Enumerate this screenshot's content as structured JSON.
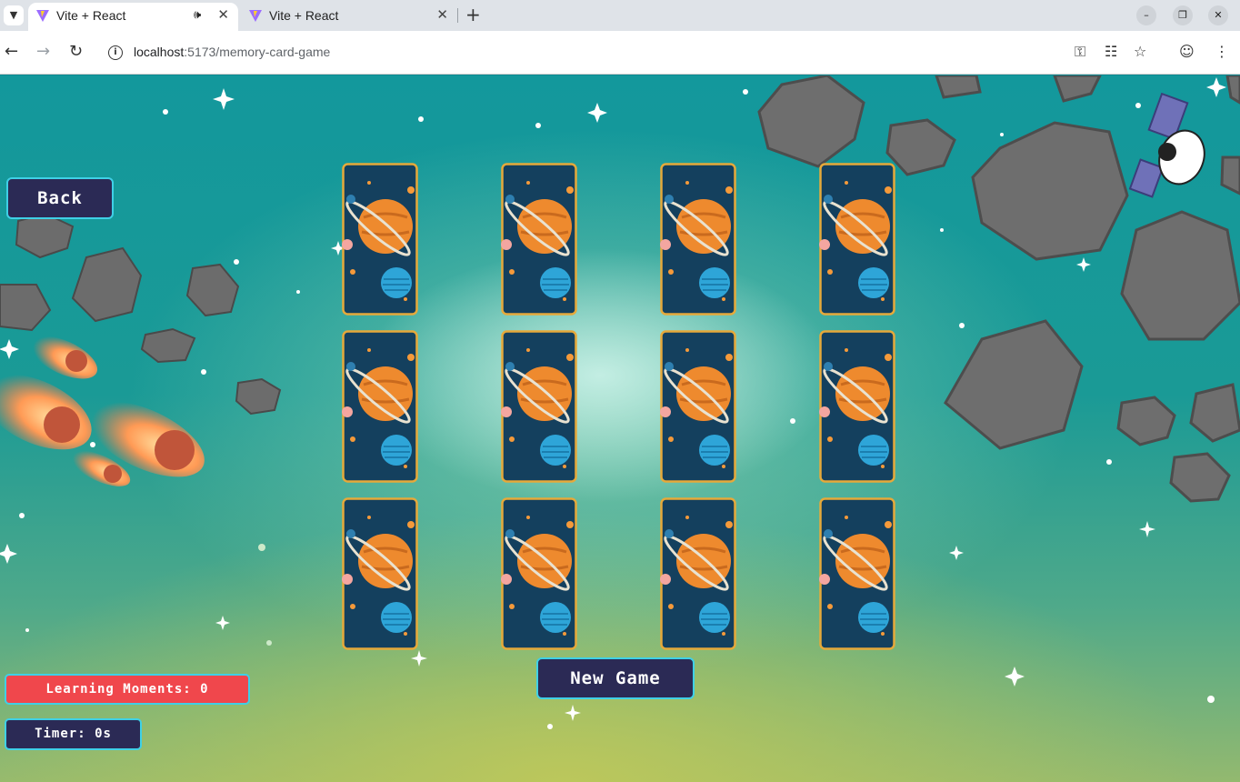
{
  "browser": {
    "tabs": [
      {
        "title": "Vite + React",
        "active": true,
        "audio": true
      },
      {
        "title": "Vite + React",
        "active": false,
        "audio": false
      }
    ],
    "url_host": "localhost",
    "url_rest": ":5173/memory-card-game"
  },
  "game": {
    "back_label": "Back",
    "new_game_label": "New Game",
    "learning_moments": "Learning Moments: 0",
    "timer": "Timer: 0s",
    "cards": [
      {
        "id": 1,
        "face_down": true
      },
      {
        "id": 2,
        "face_down": true
      },
      {
        "id": 3,
        "face_down": true
      },
      {
        "id": 4,
        "face_down": true
      },
      {
        "id": 5,
        "face_down": true
      },
      {
        "id": 6,
        "face_down": true
      },
      {
        "id": 7,
        "face_down": true
      },
      {
        "id": 8,
        "face_down": true
      },
      {
        "id": 9,
        "face_down": true
      },
      {
        "id": 10,
        "face_down": true
      },
      {
        "id": 11,
        "face_down": true
      },
      {
        "id": 12,
        "face_down": true
      }
    ]
  },
  "colors": {
    "button_bg": "#2b2a55",
    "button_border": "#3fd0e6",
    "learning_bg": "#f0474c",
    "card_border": "#e6a93a",
    "card_bg": "#14405e"
  }
}
